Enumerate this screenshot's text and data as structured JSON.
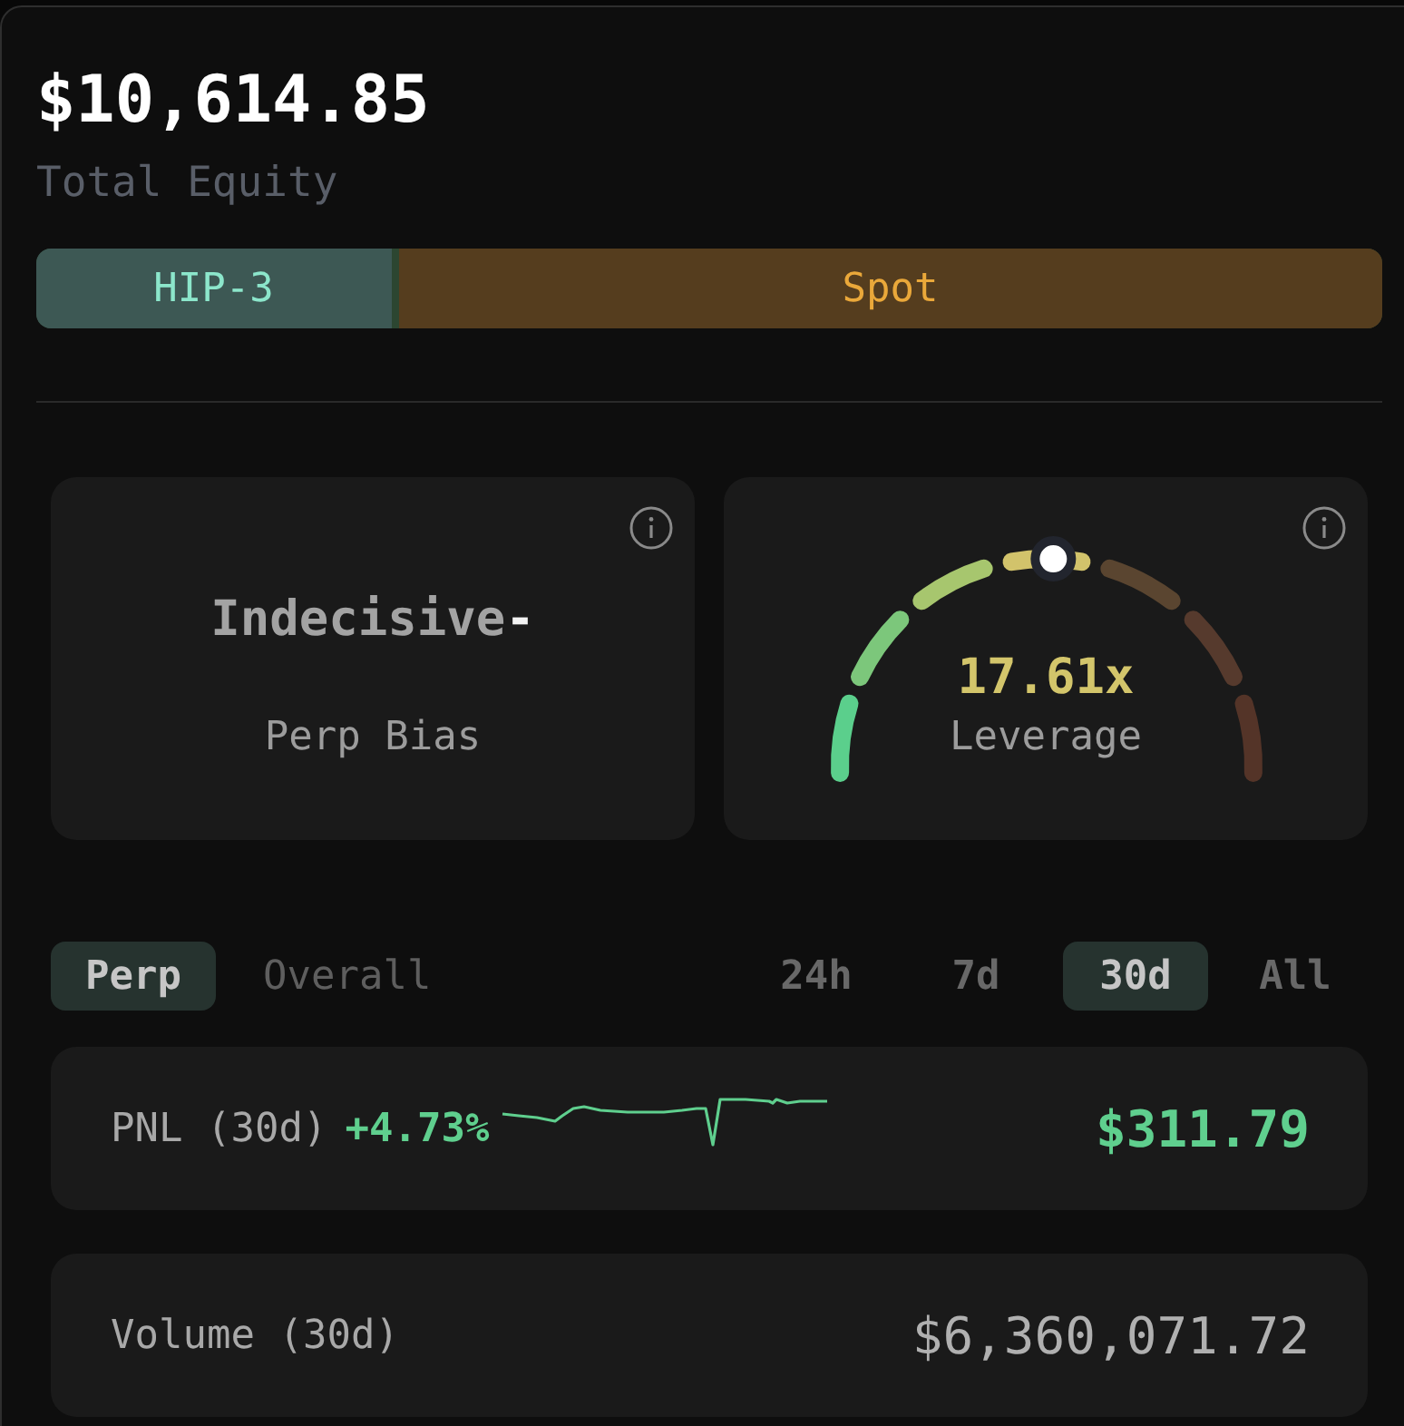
{
  "equity": {
    "value": "$10,614.85",
    "label": "Total Equity"
  },
  "allocation": [
    {
      "label": "HIP-3",
      "level": 0.265,
      "color": "#3d5854"
    },
    {
      "label": "Spot",
      "level": 0.735,
      "color": "#553d1e"
    }
  ],
  "bias_card": {
    "value": "Indecisive",
    "suffix": "-",
    "label": "Perp Bias"
  },
  "leverage_card": {
    "value": "17.61x",
    "label": "Leverage",
    "level": 0.51
  },
  "scope_tabs": [
    {
      "label": "Perp",
      "selected": true
    },
    {
      "label": "Overall",
      "selected": false
    }
  ],
  "range_tabs": [
    {
      "label": "24h",
      "selected": false
    },
    {
      "label": "7d",
      "selected": false
    },
    {
      "label": "30d",
      "selected": true
    },
    {
      "label": "All",
      "selected": false
    }
  ],
  "stats": [
    {
      "kind": "pnl",
      "label": "PNL (30d)",
      "change": "+4.73%",
      "value": "$311.79"
    },
    {
      "kind": "volume",
      "label": "Volume (30d)",
      "value": "$6,360,071.72"
    }
  ]
}
